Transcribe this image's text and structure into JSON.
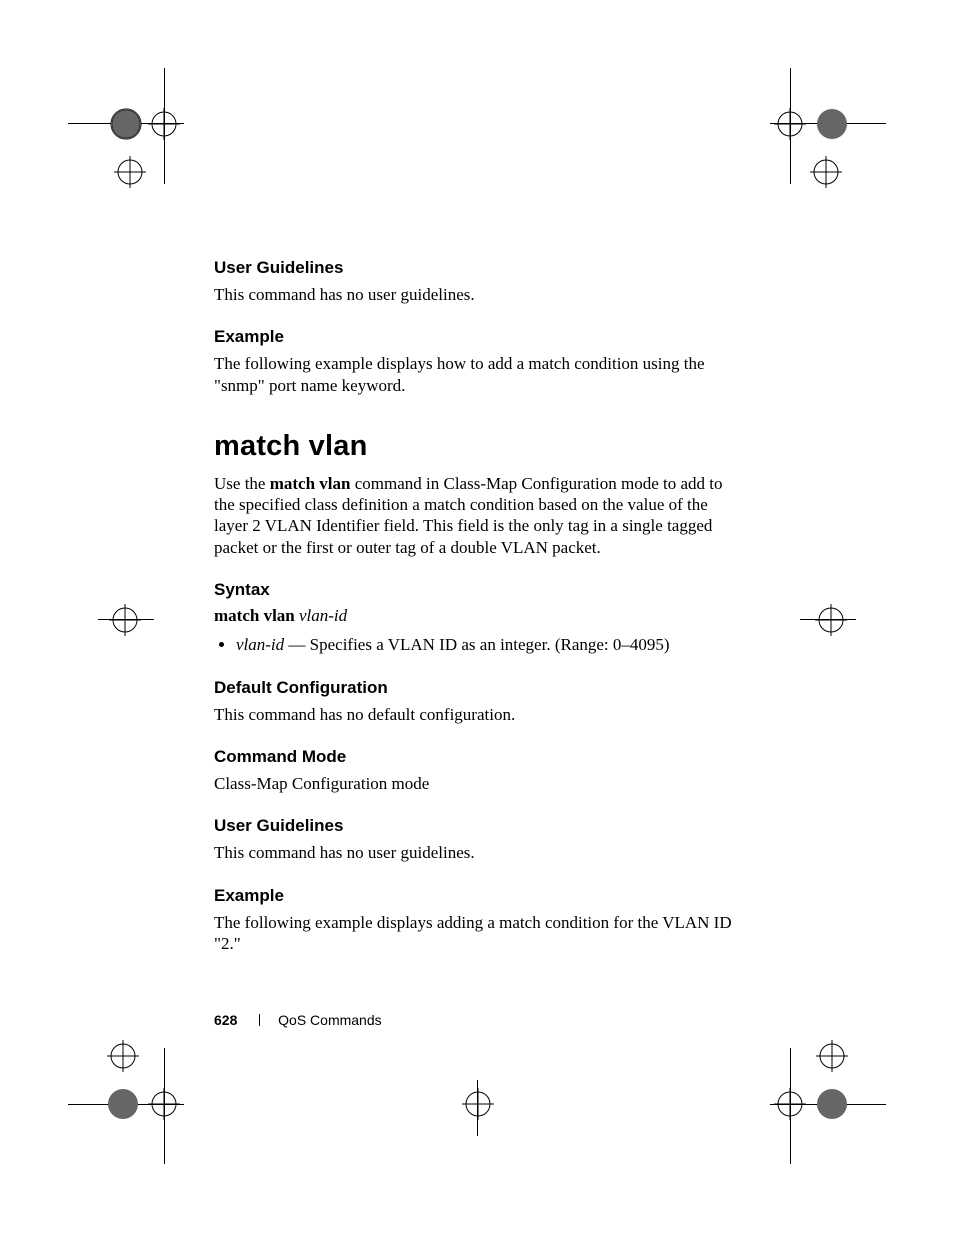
{
  "sec1": {
    "head": "User Guidelines",
    "body": "This command has no user guidelines."
  },
  "sec2": {
    "head": "Example",
    "body": "The following example displays how to add a match condition using the \"snmp\" port name keyword."
  },
  "command_title": "match vlan",
  "intro": {
    "prefix": "Use the ",
    "cmd": "match vlan",
    "suffix": " command in Class-Map Configuration mode to add to the specified class definition a match condition based on the value of the layer 2 VLAN Identifier field. This field is the only tag in a single tagged packet or the first or outer tag of a double VLAN packet."
  },
  "syntax": {
    "head": "Syntax",
    "cmd": "match vlan",
    "arg": "vlan-id",
    "param_name": "vlan-id",
    "param_desc": " — Specifies a VLAN ID as an integer. (Range: 0–4095)"
  },
  "defcfg": {
    "head": "Default Configuration",
    "body": "This command has no default configuration."
  },
  "mode": {
    "head": "Command Mode",
    "body": "Class-Map Configuration mode"
  },
  "ug2": {
    "head": "User Guidelines",
    "body": "This command has no user guidelines."
  },
  "ex2": {
    "head": "Example",
    "body": "The following example displays adding a match condition for the VLAN ID \"2.\""
  },
  "footer": {
    "page": "628",
    "section": "QoS Commands"
  }
}
